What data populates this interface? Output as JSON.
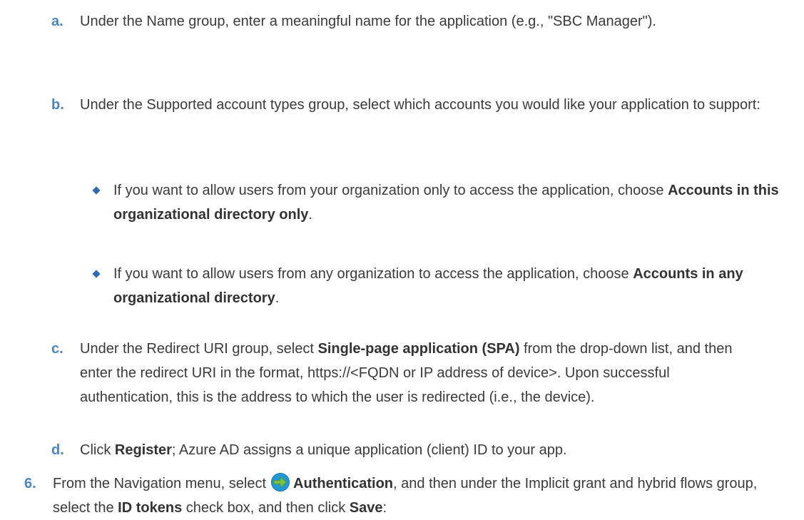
{
  "steps": {
    "a": {
      "label": "a.",
      "text": "Under the Name group, enter a meaningful name for the application (e.g., \"SBC Manager\")."
    },
    "b": {
      "label": "b.",
      "text": "Under the Supported account types group, select which accounts you would like your application to support:",
      "bullets": [
        {
          "pre": "If you want to allow users from your organization only to access the application, choose ",
          "bold": "Accounts in this organizational directory only",
          "post": "."
        },
        {
          "pre": "If you want to allow users from any organization to access the application, choose ",
          "bold": "Accounts in any organizational directory",
          "post": "."
        }
      ]
    },
    "c": {
      "label": "c.",
      "pre": "Under the Redirect URI group, select ",
      "bold": "Single-page application (SPA)",
      "post": " from the drop-down list, and then enter the redirect URI in the format, https://<FQDN or IP address of device>. Upon successful authentication, this is the address to which the user is redirected (i.e., the device)."
    },
    "d": {
      "label": "d.",
      "pre": "Click ",
      "bold": "Register",
      "post": "; Azure AD assigns a unique application (client) ID to your app."
    },
    "six": {
      "label": "6.",
      "t1": "From the Navigation menu, select",
      "icon": "authentication-arrow-icon",
      "b1": "Authentication",
      "t2": ", and then under the Implicit grant and hybrid flows group, select the ",
      "b2": "ID tokens",
      "t3": " check box, and then click ",
      "b3": "Save",
      "t4": ":"
    }
  },
  "colors": {
    "label": "#4a86c5",
    "bullet": "#2e6bb0",
    "icon_fill": "#1f9ad6",
    "icon_arrow": "#7ac143"
  }
}
